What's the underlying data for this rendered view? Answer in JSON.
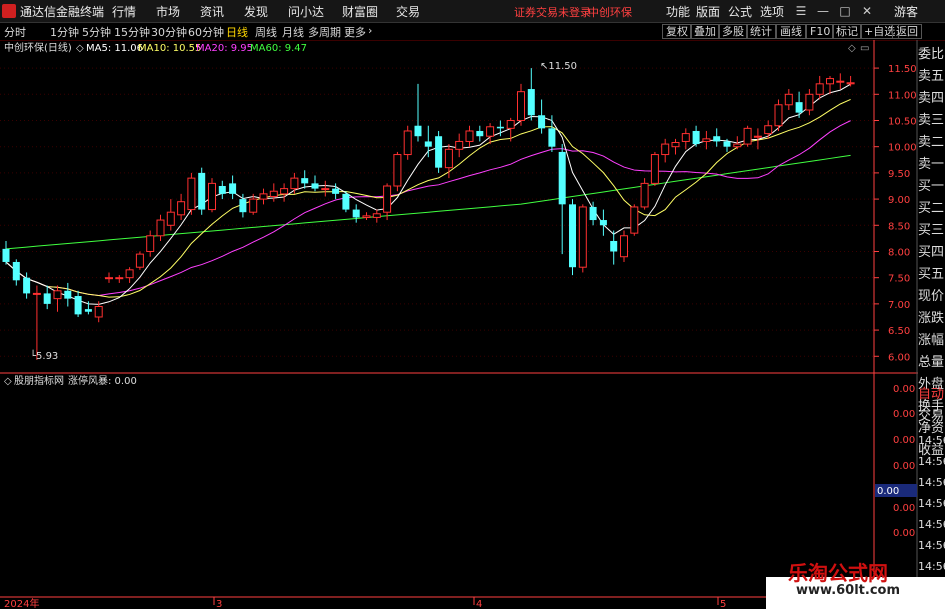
{
  "app": {
    "title": "通达信金融终端"
  },
  "menu": [
    "行情",
    "市场",
    "资讯",
    "发现",
    "问小达",
    "财富圈",
    "交易"
  ],
  "notice": "证券交易未登录",
  "stock_name_top": "中创环保",
  "right_menu": [
    "功能",
    "版面",
    "公式",
    "选项"
  ],
  "user": "游客",
  "timeframes": [
    "分时",
    "1分钟",
    "5分钟",
    "15分钟",
    "30分钟",
    "60分钟",
    "日线",
    "周线",
    "月线",
    "多周期",
    "更多"
  ],
  "active_timeframe": "日线",
  "toolbar_buttons": [
    "复权",
    "叠加",
    "多股",
    "统计",
    "画线",
    "F10",
    "标记",
    "+自选",
    "返回"
  ],
  "chart_title": "中创环保(日线)",
  "ma": {
    "ma5": "MA5: 11.06",
    "ma10": "MA10: 10.55",
    "ma20": "MA20: 9.95",
    "ma60": "MA60: 9.47"
  },
  "colors": {
    "up": "#ff3030",
    "down": "#54ffff",
    "ma5": "#ffffff",
    "ma10": "#ffff66",
    "ma20": "#ff40ff",
    "ma60": "#40ff40",
    "axis": "#ff4040"
  },
  "indicator": {
    "name": "股朋指标网",
    "value_label": "涨停风暴: 0.00"
  },
  "price_axis": [
    "11.50",
    "11.00",
    "10.50",
    "10.00",
    "9.50",
    "9.00",
    "8.50",
    "8.00",
    "7.50",
    "7.00",
    "6.50",
    "6.00"
  ],
  "indicator_axis": [
    "0.00",
    "0.00",
    "0.00",
    "0.00",
    "0.00",
    "0.00"
  ],
  "indicator_current": "0.00",
  "high_label": "11.50",
  "low_label": "5.93",
  "date_labels": [
    "2024年",
    "3",
    "4",
    "5"
  ],
  "side_labels": [
    "委比",
    "卖五",
    "卖四",
    "卖三",
    "卖二",
    "卖一",
    "买一",
    "买二",
    "买三",
    "买四",
    "买五",
    "现价",
    "涨跌",
    "涨幅",
    "总量",
    "外盘",
    "换手",
    "净资",
    "收益"
  ],
  "side_labels_lower": [
    "自动",
    "交易"
  ],
  "side_times": [
    "14:56",
    "14:56",
    "14:56",
    "14:56",
    "14:56",
    "14:56",
    "14:56",
    "14:56"
  ],
  "watermark": {
    "title": "乐淘公式网",
    "url": "www.60lt.com"
  },
  "chart_data": {
    "type": "candlestick",
    "ylim": [
      5.7,
      11.75
    ],
    "candles": [
      [
        8.05,
        8.2,
        7.75,
        7.8
      ],
      [
        7.8,
        7.85,
        7.35,
        7.45
      ],
      [
        7.5,
        7.6,
        7.1,
        7.2
      ],
      [
        7.2,
        7.35,
        5.93,
        7.2
      ],
      [
        7.2,
        7.35,
        6.9,
        7.0
      ],
      [
        7.1,
        7.35,
        6.85,
        7.25
      ],
      [
        7.25,
        7.4,
        6.95,
        7.1
      ],
      [
        7.15,
        7.25,
        6.75,
        6.8
      ],
      [
        6.9,
        7.05,
        6.8,
        6.85
      ],
      [
        6.75,
        7.05,
        6.65,
        6.95
      ],
      [
        7.5,
        7.6,
        7.4,
        7.5
      ],
      [
        7.5,
        7.55,
        7.4,
        7.5
      ],
      [
        7.5,
        7.7,
        7.4,
        7.65
      ],
      [
        7.7,
        8.0,
        7.65,
        7.95
      ],
      [
        8.0,
        8.4,
        7.9,
        8.3
      ],
      [
        8.3,
        8.7,
        8.2,
        8.6
      ],
      [
        8.5,
        9.0,
        8.4,
        8.75
      ],
      [
        8.7,
        9.1,
        8.6,
        8.95
      ],
      [
        8.8,
        9.5,
        8.7,
        9.4
      ],
      [
        9.5,
        9.6,
        8.7,
        8.8
      ],
      [
        8.8,
        9.4,
        8.75,
        9.3
      ],
      [
        9.25,
        9.35,
        9.0,
        9.1
      ],
      [
        9.3,
        9.45,
        9.0,
        9.1
      ],
      [
        9.0,
        9.1,
        8.65,
        8.75
      ],
      [
        8.75,
        9.1,
        8.7,
        9.0
      ],
      [
        9.0,
        9.2,
        8.9,
        9.1
      ],
      [
        9.05,
        9.3,
        8.95,
        9.15
      ],
      [
        9.1,
        9.3,
        8.95,
        9.2
      ],
      [
        9.2,
        9.5,
        9.1,
        9.4
      ],
      [
        9.4,
        9.55,
        9.2,
        9.3
      ],
      [
        9.3,
        9.45,
        9.15,
        9.2
      ],
      [
        9.2,
        9.35,
        9.05,
        9.2
      ],
      [
        9.2,
        9.3,
        9.0,
        9.1
      ],
      [
        9.1,
        9.15,
        8.75,
        8.8
      ],
      [
        8.8,
        8.9,
        8.55,
        8.65
      ],
      [
        8.65,
        8.75,
        8.6,
        8.68
      ],
      [
        8.65,
        8.8,
        8.55,
        8.72
      ],
      [
        8.75,
        9.3,
        8.6,
        9.25
      ],
      [
        9.25,
        9.9,
        9.15,
        9.85
      ],
      [
        9.85,
        10.4,
        9.75,
        10.3
      ],
      [
        10.4,
        11.2,
        10.1,
        10.2
      ],
      [
        10.1,
        10.4,
        9.8,
        10.0
      ],
      [
        10.2,
        10.3,
        9.5,
        9.6
      ],
      [
        9.6,
        10.05,
        9.4,
        9.95
      ],
      [
        9.95,
        10.25,
        9.8,
        10.1
      ],
      [
        10.1,
        10.4,
        10.0,
        10.3
      ],
      [
        10.3,
        10.4,
        10.1,
        10.2
      ],
      [
        10.2,
        10.45,
        10.05,
        10.38
      ],
      [
        10.38,
        10.5,
        10.2,
        10.35
      ],
      [
        10.35,
        10.55,
        10.1,
        10.5
      ],
      [
        10.5,
        11.2,
        10.4,
        11.05
      ],
      [
        11.1,
        11.5,
        10.5,
        10.6
      ],
      [
        10.6,
        10.9,
        10.25,
        10.35
      ],
      [
        10.35,
        10.6,
        9.9,
        10.0
      ],
      [
        9.9,
        10.05,
        7.95,
        8.9
      ],
      [
        8.9,
        9.0,
        7.55,
        7.7
      ],
      [
        7.7,
        8.9,
        7.6,
        8.85
      ],
      [
        8.85,
        8.95,
        8.5,
        8.6
      ],
      [
        8.6,
        8.8,
        8.3,
        8.5
      ],
      [
        8.2,
        8.4,
        7.75,
        8.0
      ],
      [
        7.9,
        8.4,
        7.8,
        8.3
      ],
      [
        8.35,
        8.9,
        8.3,
        8.85
      ],
      [
        8.85,
        9.4,
        8.8,
        9.3
      ],
      [
        9.3,
        9.9,
        9.25,
        9.85
      ],
      [
        9.85,
        10.15,
        9.7,
        10.05
      ],
      [
        10.0,
        10.15,
        9.85,
        10.08
      ],
      [
        10.1,
        10.35,
        9.95,
        10.25
      ],
      [
        10.3,
        10.4,
        10.0,
        10.05
      ],
      [
        10.1,
        10.3,
        9.95,
        10.15
      ],
      [
        10.2,
        10.35,
        10.0,
        10.1
      ],
      [
        10.1,
        10.15,
        9.9,
        10.0
      ],
      [
        10.0,
        10.2,
        9.95,
        10.05
      ],
      [
        10.05,
        10.4,
        10.0,
        10.35
      ],
      [
        10.2,
        10.35,
        9.95,
        10.2
      ],
      [
        10.25,
        10.5,
        10.15,
        10.4
      ],
      [
        10.4,
        10.9,
        10.3,
        10.8
      ],
      [
        10.8,
        11.1,
        10.7,
        11.0
      ],
      [
        10.85,
        11.05,
        10.55,
        10.65
      ],
      [
        10.7,
        11.1,
        10.6,
        11.0
      ],
      [
        11.0,
        11.35,
        10.9,
        11.2
      ],
      [
        11.2,
        11.35,
        11.0,
        11.3
      ],
      [
        11.25,
        11.4,
        11.1,
        11.25
      ],
      [
        11.2,
        11.35,
        11.15,
        11.22
      ]
    ]
  }
}
